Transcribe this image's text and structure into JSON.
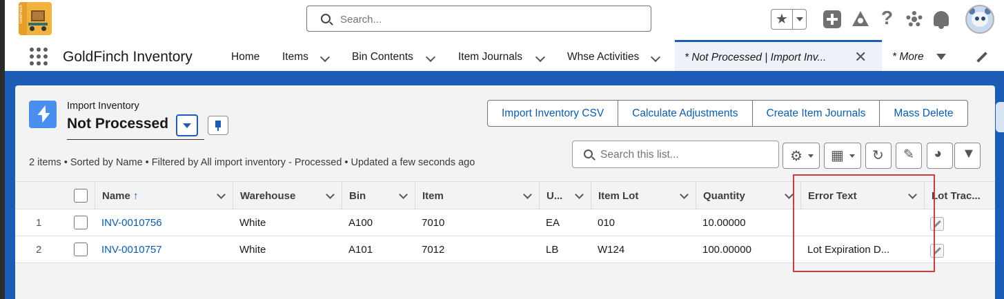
{
  "global_header": {
    "logo_text": "GoldFinch",
    "search_placeholder": "Search..."
  },
  "nav": {
    "app_name": "GoldFinch Inventory",
    "items": [
      {
        "label": "Home",
        "has_menu": false
      },
      {
        "label": "Items",
        "has_menu": true
      },
      {
        "label": "Bin Contents",
        "has_menu": true
      },
      {
        "label": "Item Journals",
        "has_menu": true
      },
      {
        "label": "Whse Activities",
        "has_menu": true
      }
    ],
    "active_tab": "* Not Processed | Import Inv...",
    "more_label": "* More"
  },
  "list_view": {
    "object_label": "Import Inventory",
    "view_name": "Not Processed",
    "actions": [
      "Import Inventory CSV",
      "Calculate Adjustments",
      "Create Item Journals",
      "Mass Delete"
    ],
    "search_placeholder": "Search this list...",
    "summary": "2 items • Sorted by Name • Filtered by All import inventory - Processed • Updated a few seconds ago"
  },
  "table": {
    "columns": [
      "Name",
      "Warehouse",
      "Bin",
      "Item",
      "U...",
      "Item Lot",
      "Quantity",
      "Error Text",
      "Lot Trac..."
    ],
    "sort_indicator": "↑",
    "rows": [
      {
        "num": "1",
        "name": "INV-0010756",
        "warehouse": "White",
        "bin": "A100",
        "item": "7010",
        "uom": "EA",
        "item_lot": "010",
        "quantity": "10.00000",
        "error_text": ""
      },
      {
        "num": "2",
        "name": "INV-0010757",
        "warehouse": "White",
        "bin": "A101",
        "item": "7012",
        "uom": "LB",
        "item_lot": "W124",
        "quantity": "100.00000",
        "error_text": "Lot Expiration D..."
      }
    ]
  },
  "colors": {
    "brand_blue": "#1b5cb6",
    "link_blue": "#0b5cab",
    "highlight_red": "#d9363e"
  }
}
